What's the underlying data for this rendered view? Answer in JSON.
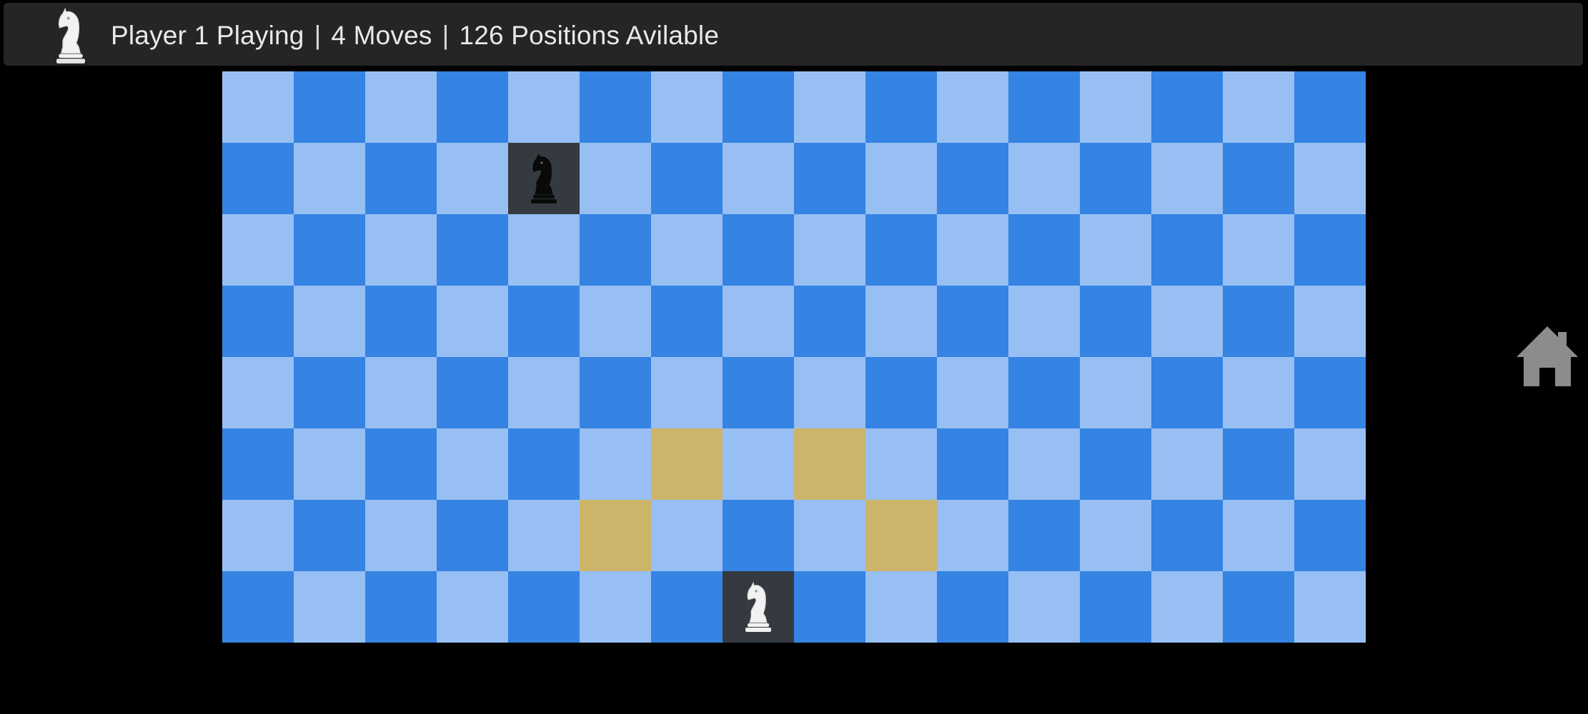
{
  "status": {
    "player": "Player 1 Playing",
    "moves": "4 Moves",
    "positions": "126 Positions Avilable",
    "separator": "|",
    "icon": "white-knight-icon"
  },
  "board": {
    "columns": 16,
    "rows": 8,
    "colors": {
      "light": "#97bff4",
      "dark": "#3583e2",
      "hint": "#ccb46a",
      "occupied": "#343a40"
    },
    "pieces": [
      {
        "name": "black-knight",
        "color": "black",
        "row": 1,
        "col": 4
      },
      {
        "name": "white-knight",
        "color": "white",
        "row": 7,
        "col": 7
      }
    ],
    "available_moves": [
      {
        "row": 5,
        "col": 6
      },
      {
        "row": 5,
        "col": 8
      },
      {
        "row": 6,
        "col": 5
      },
      {
        "row": 6,
        "col": 9
      }
    ]
  },
  "home_button": {
    "icon": "home-icon",
    "color": "#8c8c8c"
  }
}
